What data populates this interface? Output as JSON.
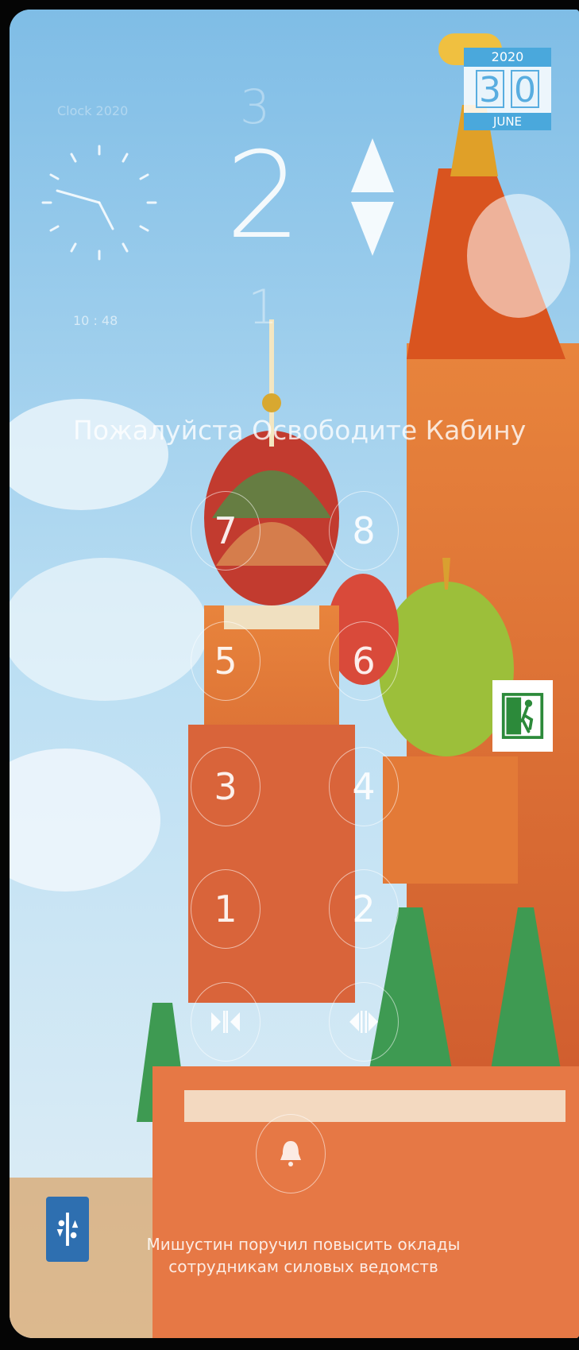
{
  "calendar": {
    "year": "2020",
    "day_digits": [
      "3",
      "0"
    ],
    "month": "JUNE"
  },
  "clock": {
    "title": "Clock 2020",
    "time": "10 : 48"
  },
  "floor": {
    "previous": "3",
    "current": "2",
    "next": "1"
  },
  "message": "Пожалуйста Освободите Кабину",
  "buttons": [
    {
      "label": "7"
    },
    {
      "label": "8"
    },
    {
      "label": "5"
    },
    {
      "label": "6"
    },
    {
      "label": "3"
    },
    {
      "label": "4"
    },
    {
      "label": "1"
    },
    {
      "label": "2"
    }
  ],
  "door_controls": {
    "open_icon": "door-open-icon",
    "close_icon": "door-close-icon"
  },
  "icons": {
    "exit": "emergency-exit-icon",
    "logo": "elevator-logo-icon"
  },
  "news_ticker": "Мишустин поручил повысить оклады сотрудникам силовых ведомств",
  "colors": {
    "accent": "#4aa8dc",
    "logo": "#2e6fb0"
  }
}
